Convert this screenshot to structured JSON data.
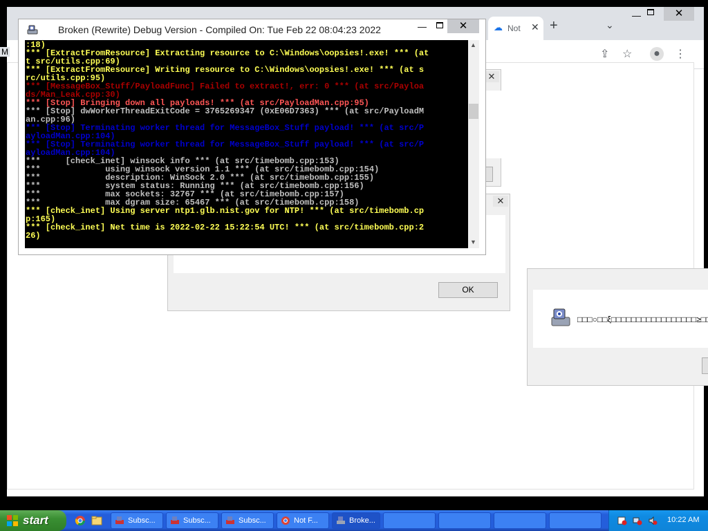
{
  "browser": {
    "tab_label": "Not",
    "tab_close": "✕",
    "new_tab": "+",
    "tab_menu": "⌄",
    "win_min": "—",
    "win_close": "✕",
    "side_letter": "M"
  },
  "dialog_ok": {
    "close": "✕",
    "ok_label": "OK"
  },
  "dialog_message": {
    "text": "□□□○□□ξ□□□□□□□□□□□□□□□□□≥□□□"
  },
  "console": {
    "title": "Broken (Rewrite) Debug Version - Compiled On: Tue Feb 22 08:04:23 2022",
    "min": "—",
    "close": "✕",
    "lines": [
      {
        "text": ":18)",
        "color": "#ffff55"
      },
      {
        "text": "*** [ExtractFromResource] Extracting resource to C:\\Windows\\oopsies!.exe! *** (at",
        "color": "#ffff55"
      },
      {
        "text": "t src/utils.cpp:69)",
        "color": "#ffff55"
      },
      {
        "text": "*** [ExtractFromResource] Writing resource to C:\\Windows\\oopsies!.exe! *** (at s",
        "color": "#ffff55"
      },
      {
        "text": "rc/utils.cpp:95)",
        "color": "#ffff55"
      },
      {
        "text": "*** [MessageBox_Stuff/PayloadFunc] Failed to extract!, err: 0 *** (at src/Payloa",
        "color": "#aa0000"
      },
      {
        "text": "ds/Man_Leak.cpp:30)",
        "color": "#aa0000"
      },
      {
        "text": "*** [Stop] Bringing down all payloads! *** (at src/PayloadMan.cpp:95)",
        "color": "#ff5555"
      },
      {
        "text": "*** [Stop] dwWorkerThreadExitCode = 3765269347 (0xE06D7363) *** (at src/PayloadM",
        "color": "#c0c0c0"
      },
      {
        "text": "an.cpp:96)",
        "color": "#c0c0c0"
      },
      {
        "text": "*** [Stop] Terminating worker thread for MessageBox_Stuff payload! *** (at src/P",
        "color": "#0000cc"
      },
      {
        "text": "ayloadMan.cpp:104)",
        "color": "#0000cc"
      },
      {
        "text": "*** [Stop] Terminating worker thread for MessageBox_Stuff payload! *** (at src/P",
        "color": "#0000cc"
      },
      {
        "text": "ayloadMan.cpp:104)",
        "color": "#0000cc"
      },
      {
        "text": "***     [check_inet] winsock info *** (at src/timebomb.cpp:153)",
        "color": "#c0c0c0"
      },
      {
        "text": "***             using winsock version 1.1 *** (at src/timebomb.cpp:154)",
        "color": "#c0c0c0"
      },
      {
        "text": "***             description: WinSock 2.0 *** (at src/timebomb.cpp:155)",
        "color": "#c0c0c0"
      },
      {
        "text": "***             system status: Running *** (at src/timebomb.cpp:156)",
        "color": "#c0c0c0"
      },
      {
        "text": "***             max sockets: 32767 *** (at src/timebomb.cpp:157)",
        "color": "#c0c0c0"
      },
      {
        "text": "***             max dgram size: 65467 *** (at src/timebomb.cpp:158)",
        "color": "#c0c0c0"
      },
      {
        "text": "*** [check_inet] Using server ntp1.glb.nist.gov for NTP! *** (at src/timebomb.cp",
        "color": "#ffff55"
      },
      {
        "text": "p:165)",
        "color": "#ffff55"
      },
      {
        "text": "*** [check_inet] Net time is 2022-02-22 15:22:54 UTC! *** (at src/timebomb.cpp:2",
        "color": "#ffff55"
      },
      {
        "text": "26)",
        "color": "#ffff55"
      }
    ]
  },
  "taskbar": {
    "start_label": "start",
    "tasks": [
      {
        "label": "Subsc..."
      },
      {
        "label": "Subsc..."
      },
      {
        "label": "Subsc..."
      },
      {
        "label": "Not F..."
      },
      {
        "label": "Broke..."
      }
    ],
    "clock": "10:22 AM"
  }
}
